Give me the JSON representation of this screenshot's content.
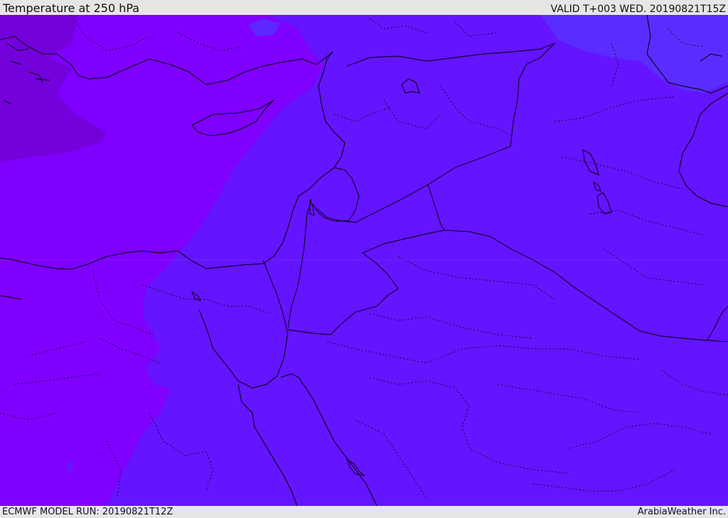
{
  "header": {
    "title": "Temperature at 250 hPa",
    "valid": "VALID T+003 WED. 20190821T15Z"
  },
  "footer": {
    "model_run": "ECMWF MODEL RUN: 20190821T12Z",
    "credit": "ArabiaWeather Inc."
  },
  "colors": {
    "coldest": "#7a00d8",
    "cold": "#7f00ff",
    "mid": "#6612ff",
    "warm": "#5a2cff",
    "border": "#000000",
    "frame": "#e6e6e6"
  }
}
